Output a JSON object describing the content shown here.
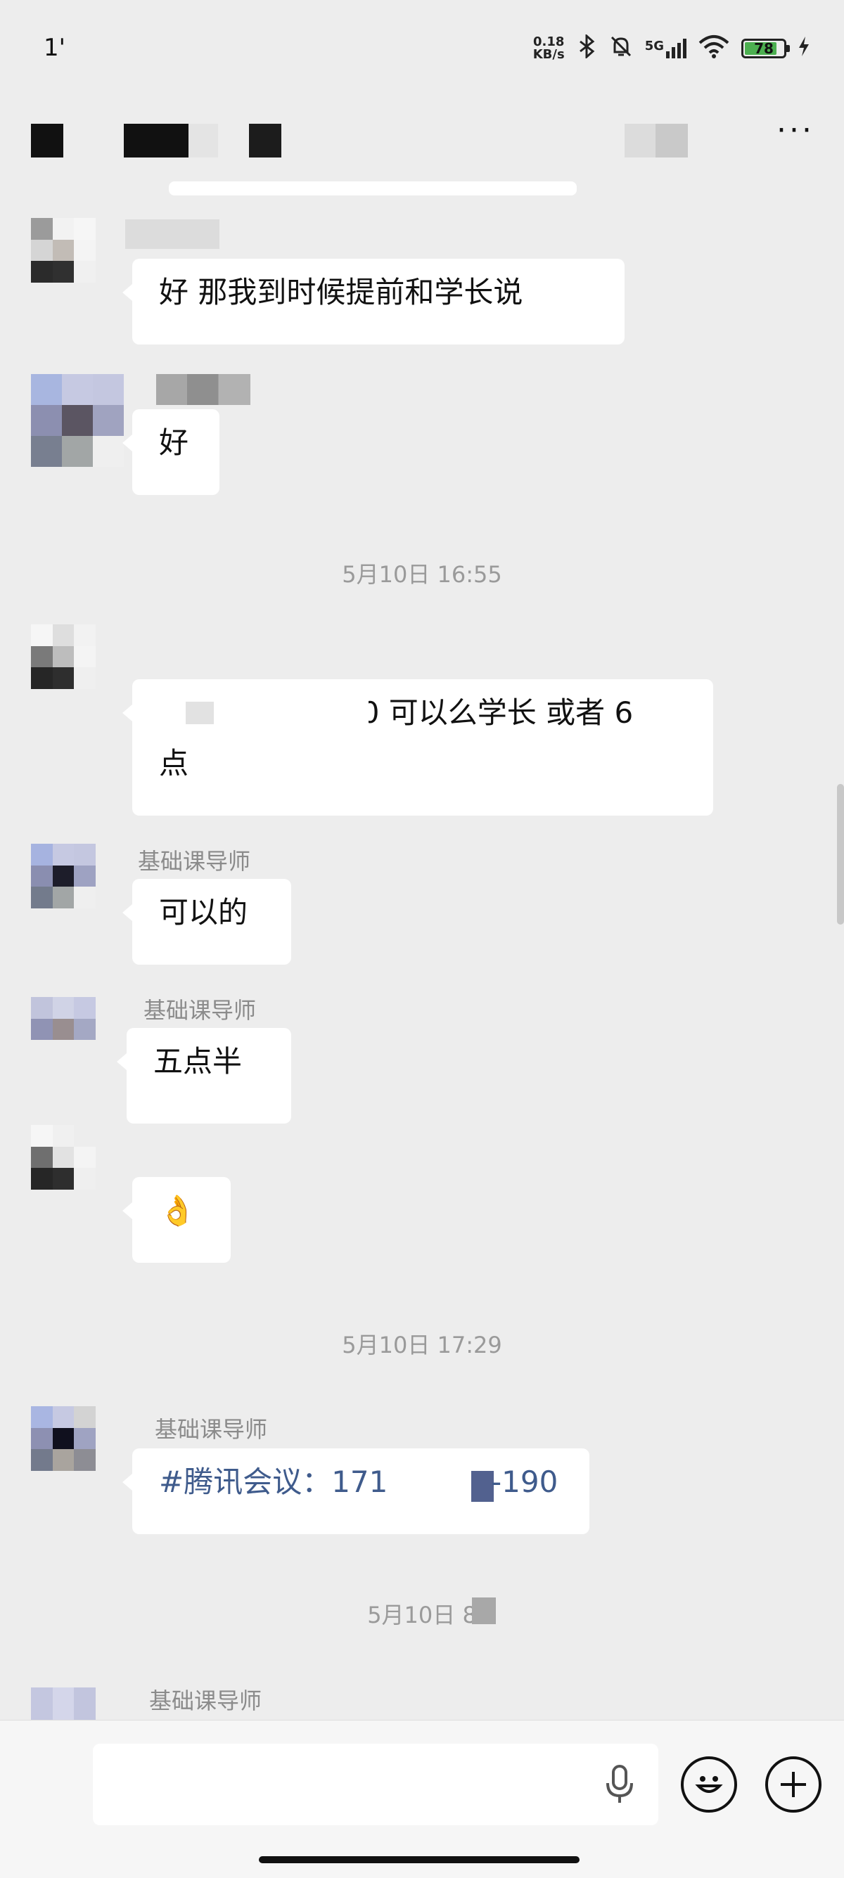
{
  "status_bar": {
    "time": "1'",
    "net_speed_value": "0.18",
    "net_speed_unit": "KB/s",
    "signal": "5G",
    "battery": "78",
    "icons": [
      "bluetooth-icon",
      "mute-bell-icon",
      "cell-signal-icon",
      "wifi-icon",
      "battery-icon",
      "charging-icon"
    ]
  },
  "header": {
    "more_label": "···"
  },
  "messages": {
    "m1_text": "好 那我到时候提前和学长说",
    "m2_text": "好",
    "ts1": "5月10日 16:55",
    "m3_line1": "30 可以么学长 或者 6",
    "m3_line2": "点",
    "m4_sender": "基础课导师",
    "m4_text": "可以的",
    "m5_sender": "基础课导师",
    "m5_text": "五点半",
    "m6_text": "👌",
    "ts2": "5月10日 17:29",
    "m7_sender": "基础课导师",
    "m7_text_start": "#腾讯会议：171",
    "m7_text_end": "-190",
    "ts3": "5月10日",
    "ts3_tail": "8",
    "m8_sender": "基础课导师"
  },
  "input_bar": {
    "voice_icon": "microphone-icon",
    "emoji_icon": "emoji-icon",
    "plus_icon": "plus-icon"
  },
  "colors": {
    "background": "#ededed",
    "bubble": "#ffffff",
    "link": "#3f5b8c",
    "timestamp": "#9a9a9a"
  }
}
